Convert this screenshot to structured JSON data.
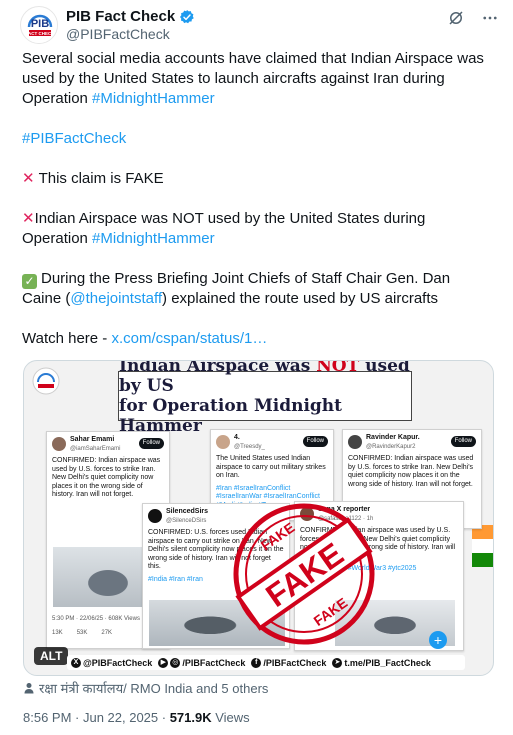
{
  "account": {
    "display_name": "PIB Fact Check",
    "handle": "@PIBFactCheck",
    "avatar_text": "PIB",
    "avatar_subtext": "FACT CHECK"
  },
  "tweet": {
    "line1_text": "Several social media accounts have claimed that Indian Airspace was used by the United States to launch aircrafts against Iran during Operation ",
    "line1_hashtag": "#MidnightHammer",
    "hashtag2": "#PIBFactCheck",
    "claim_fake": "This claim is FAKE",
    "not_used_text": "Indian Airspace was NOT used by the United States during Operation ",
    "not_used_hashtag": "#MidnightHammer",
    "briefing_text": "During the Press Briefing Joint Chiefs of Staff Chair Gen. Dan Caine (",
    "briefing_mention": "@thejointstaff",
    "briefing_tail": ") explained the route used by US aircrafts",
    "watch_label": "Watch here - ",
    "watch_link": "x.com/cspan/status/1…"
  },
  "media": {
    "banner_line1_pre": "Indian Airspace was ",
    "banner_not": "NOT",
    "banner_line1_post": " used by US",
    "banner_line2": "for Operation Midnight Hammer",
    "alt_label": "ALT",
    "stamp_word": "FAKE",
    "cards": {
      "c1": {
        "name": "Sahar Emami",
        "handle": "@iamSaharEmami",
        "follow": "Follow",
        "body": "CONFIRMED: Indian airspace was used by U.S. forces to strike Iran. New Delhi's quiet complicity now places it on the wrong side of history. Iran will not forget.",
        "time": "5:30 PM · 22/06/25 · 608K Views",
        "stat1": "13K",
        "stat2": "53K",
        "stat3": "27K"
      },
      "c2": {
        "name": "4.",
        "handle": "@Treesdy_",
        "follow": "Follow",
        "body": "The United States used Indian airspace to carry out military strikes on Iran.",
        "tags": "#Iran #IsraelIranConflict #IsraelIranWar #IsraelIranConflict #Modi #India #Trump"
      },
      "c3": {
        "name": "Ravinder Kapur.",
        "handle": "@RavinderKapur2",
        "follow": "Follow",
        "body": "CONFIRMED: Indian airspace was used by U.S. forces to strike Iran. New Delhi's quiet complicity now places it on the wrong side of history. Iran will not forget."
      },
      "c4": {
        "name": "SilencedSirs",
        "handle": "@SilenceDSirs",
        "body": "CONFIRMED: U.S. forces used Indian airspace to carry out strike on Iran. New Delhi's silent complicity now places it on the wrong side of history. Iran will not forget this.",
        "tags": "#India #Iran #Iran"
      },
      "c5": {
        "name": "Sana X reporter",
        "handle": "@safasana1122 · 1h",
        "body": "CONFIRMED: Indian airspace was used by U.S. forces to strike Iran. New Delhi's quiet complicity now places it on the wrong side of history. Iran will not forget.",
        "tags": "#IsraelIranWar #WorldWar3 #ytc2025"
      }
    },
    "footer": {
      "x": "@PIBFactCheck",
      "ig": "/PIBFactCheck",
      "fb": "/PIBFactCheck",
      "tg": "t.me/PIB_FactCheck"
    }
  },
  "tagged_people": "रक्षा मंत्री कार्यालय/ RMO India and 5 others",
  "meta": {
    "time": "8:56 PM · Jun 22, 2025 · ",
    "views": "571.9K",
    "views_label": " Views"
  },
  "colors": {
    "link": "#1d9bf0",
    "fake_red": "#e0245e",
    "stamp_red": "#d0021b",
    "verified": "#1d9bf0"
  }
}
